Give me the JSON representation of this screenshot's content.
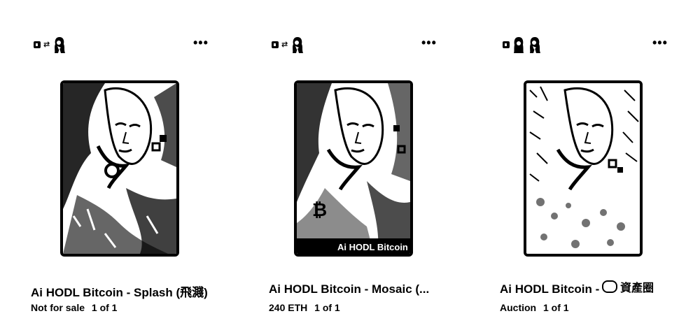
{
  "cards": [
    {
      "title": "Ai HODL Bitcoin - Splash (飛濺)",
      "status": "Not for sale",
      "edition": "1 of 1",
      "more_label": "•••"
    },
    {
      "title": "Ai HODL Bitcoin - Mosaic (...",
      "status": "240 ETH",
      "edition": "1 of 1",
      "more_label": "•••",
      "art_caption": "Ai HODL Bitcoin"
    },
    {
      "title": "Ai HODL Bitcoin - ",
      "status": "Auction",
      "edition": "1 of 1",
      "more_label": "•••"
    }
  ],
  "overlay_watermark": "資產圈",
  "icons": {
    "more": "more-horizontal-icon",
    "creator": "creator-avatar-icon",
    "bitcoin": "bitcoin-icon"
  }
}
